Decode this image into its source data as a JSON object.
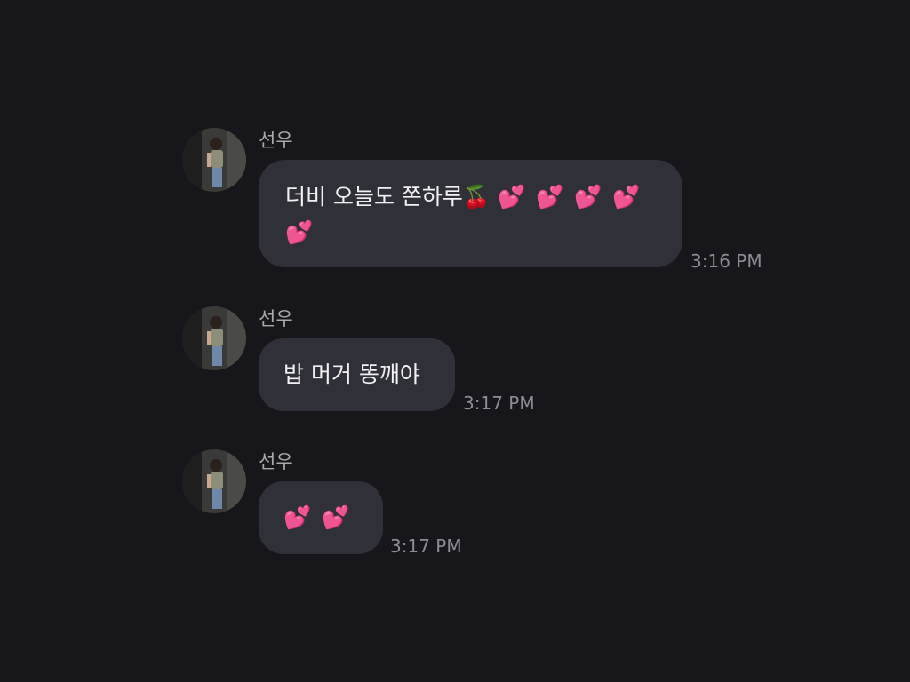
{
  "messages": [
    {
      "sender": "선우",
      "text_main": "더비 오늘도 쫀하루",
      "emoji_cherry": "🍒",
      "emoji_row1": "💕 💕 💕 💕",
      "emoji_row2": "💕",
      "time": "3:16 PM"
    },
    {
      "sender": "선우",
      "text_main": "밥 머거 똥깨야",
      "time": "3:17 PM"
    },
    {
      "sender": "선우",
      "emoji_row1": "💕 💕",
      "time": "3:17 PM"
    }
  ],
  "colors": {
    "background": "#17171b",
    "bubble": "#303138",
    "sender_text": "#a9a9ad",
    "time_text": "#8c8c92",
    "message_text": "#f1f1f3"
  },
  "icons": {
    "avatar": "avatar-photo"
  }
}
